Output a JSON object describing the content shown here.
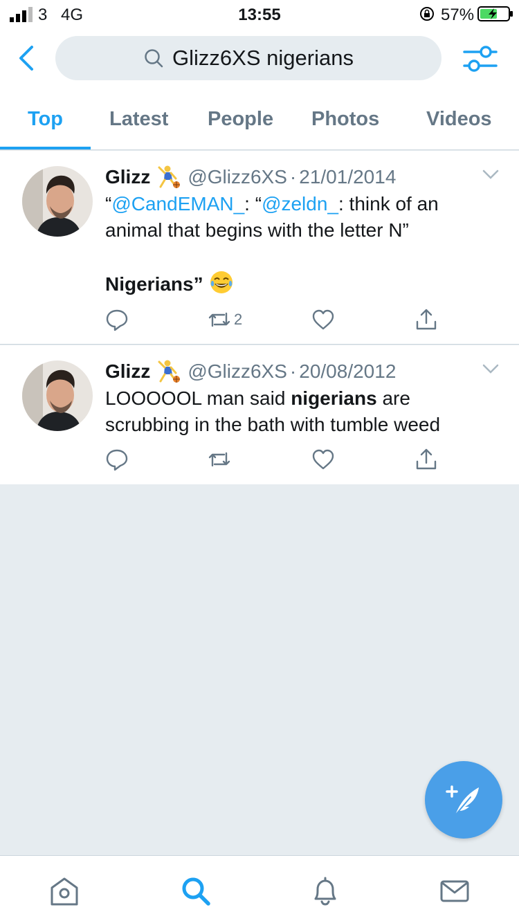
{
  "status_bar": {
    "carrier": "3",
    "network": "4G",
    "time": "13:55",
    "battery": "57%"
  },
  "search": {
    "query": "Glizz6XS nigerians"
  },
  "tabs": [
    {
      "label": "Top",
      "active": true
    },
    {
      "label": "Latest",
      "active": false
    },
    {
      "label": "People",
      "active": false
    },
    {
      "label": "Photos",
      "active": false
    },
    {
      "label": "Videos",
      "active": false
    }
  ],
  "tweets": [
    {
      "name": "Glizz",
      "handle": "@Glizz6XS",
      "separator": "·",
      "date": "21/01/2014",
      "line1_quote1": "“",
      "mention1": "@CandEMAN_",
      "line1_mid": ": “",
      "mention2": "@zeldn_",
      "line1_rest": ": think of an animal that begins with the letter N”",
      "line2": "Nigerians”",
      "retweet_count": "2"
    },
    {
      "name": "Glizz",
      "handle": "@Glizz6XS",
      "separator": "·",
      "date": "20/08/2012",
      "text_before": "LOOOOOL man said ",
      "text_bold": "nigerians",
      "text_after": " are scrubbing in the bath with tumble weed",
      "retweet_count": ""
    }
  ],
  "colors": {
    "accent": "#1da1f2",
    "muted": "#657786",
    "background": "#e6ecf0"
  },
  "icons": {
    "nav": [
      "home-icon",
      "search-icon",
      "notifications-icon",
      "messages-icon"
    ],
    "actions": [
      "reply-icon",
      "retweet-icon",
      "like-icon",
      "share-icon"
    ]
  }
}
